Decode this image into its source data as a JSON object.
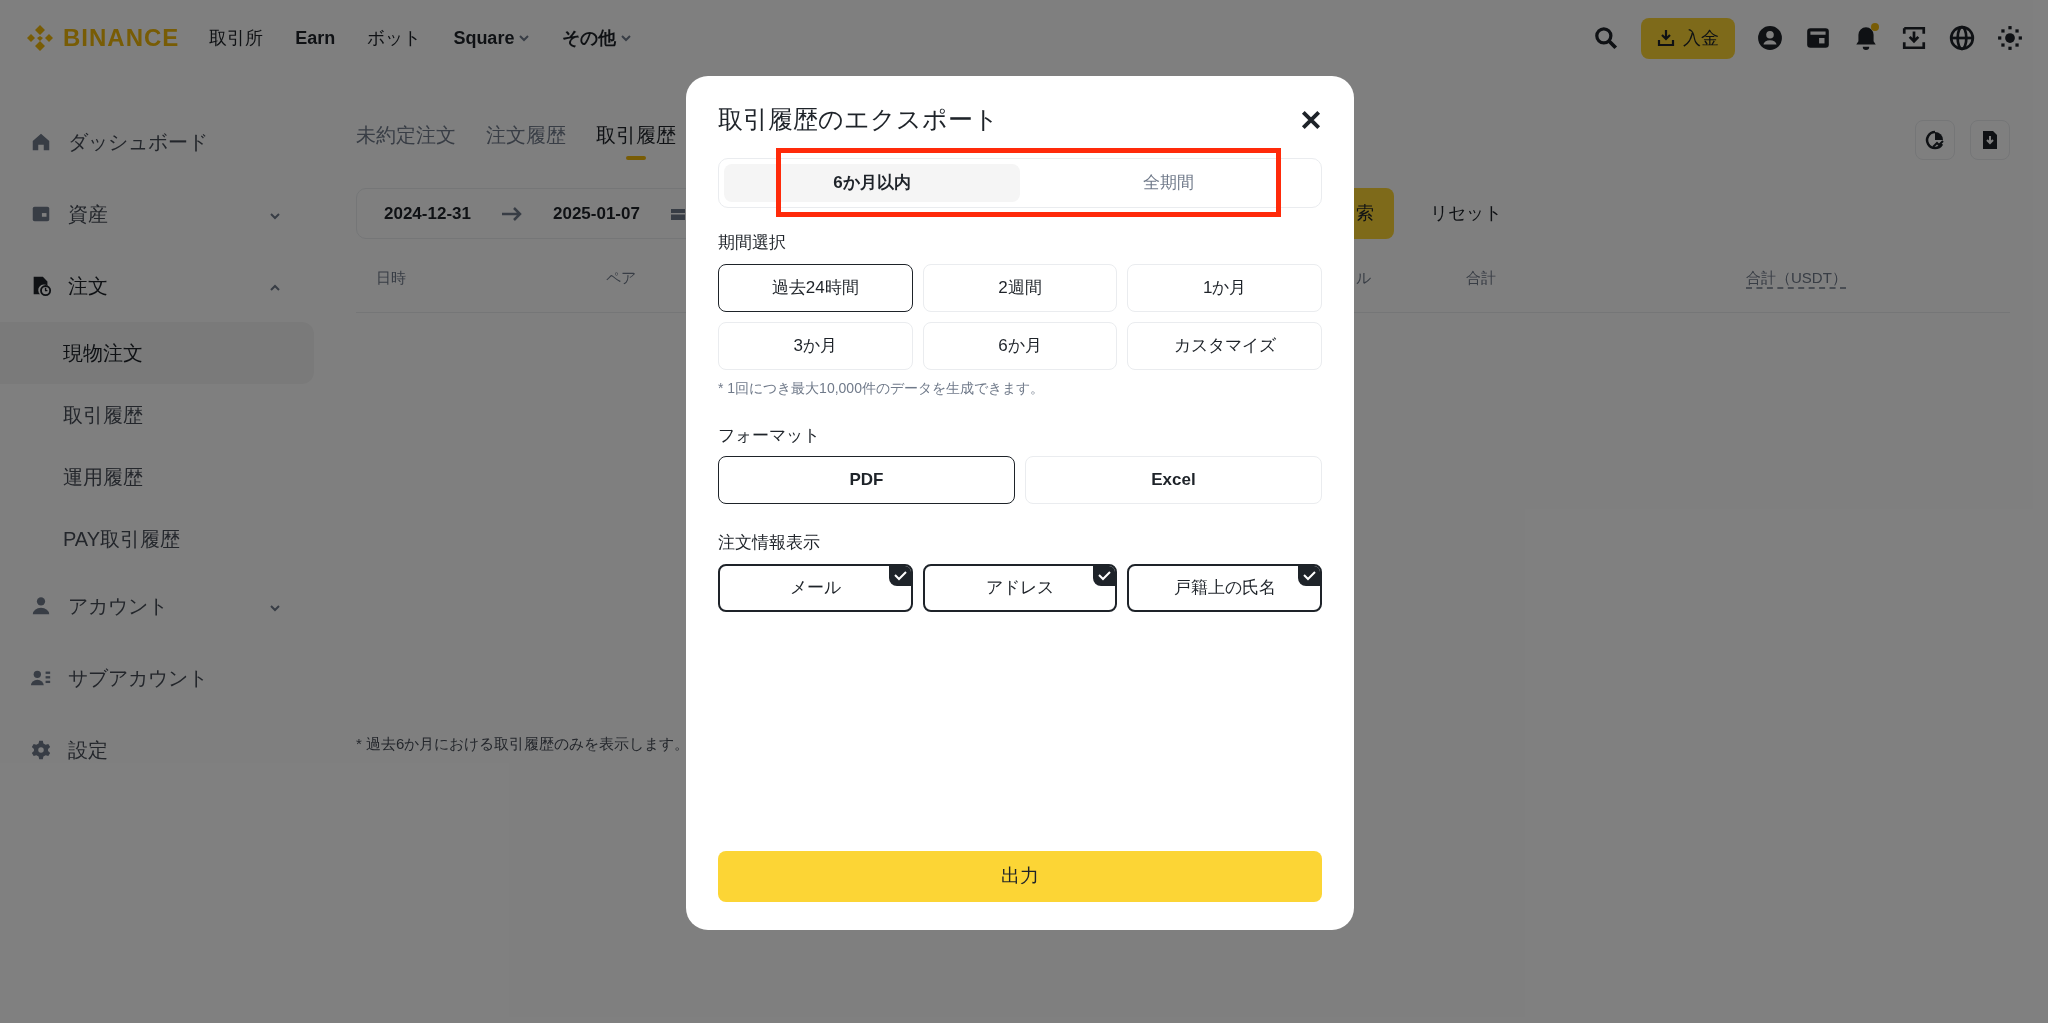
{
  "header": {
    "logo": "BINANCE",
    "nav": [
      {
        "label": "取引所",
        "caret": false
      },
      {
        "label": "Earn",
        "caret": false
      },
      {
        "label": "ボット",
        "caret": false
      },
      {
        "label": "Square",
        "caret": true
      },
      {
        "label": "その他",
        "caret": true
      }
    ],
    "deposit_button": "入金",
    "notification_dot": true
  },
  "sidebar": {
    "items": [
      {
        "label": "ダッシュボード"
      },
      {
        "label": "資産",
        "expanded": false
      },
      {
        "label": "注文",
        "expanded": true,
        "children": [
          {
            "label": "現物注文",
            "selected": true
          },
          {
            "label": "取引履歴",
            "selected": false
          },
          {
            "label": "運用履歴",
            "selected": false
          },
          {
            "label": "PAY取引履歴",
            "selected": false
          }
        ]
      },
      {
        "label": "アカウント",
        "expanded": false
      },
      {
        "label": "サブアカウント"
      },
      {
        "label": "設定"
      }
    ]
  },
  "main": {
    "tabs": [
      {
        "label": "未約定注文",
        "selected": false
      },
      {
        "label": "注文履歴",
        "selected": false
      },
      {
        "label": "取引履歴",
        "selected": true
      }
    ],
    "date_range": {
      "start": "2024-12-31",
      "end": "2025-01-07"
    },
    "search_button": "索",
    "reset_button": "リセット",
    "table": {
      "columns": [
        {
          "label": "日時",
          "underlined": false
        },
        {
          "label": "ペア",
          "underlined": false
        },
        {
          "label": "ル",
          "underlined": false
        },
        {
          "label": "合計",
          "underlined": false
        },
        {
          "label": "合計（USDT）",
          "underlined": true
        }
      ]
    },
    "footnote": "* 過去6か月における取引履歴のみを表示します。"
  },
  "dialog": {
    "title": "取引履歴のエクスポート",
    "highlighted": true,
    "scope_tabs": [
      {
        "label": "6か月以内",
        "selected": true
      },
      {
        "label": "全期間",
        "selected": false
      }
    ],
    "period_label": "期間選択",
    "periods": [
      {
        "label": "過去24時間",
        "selected": true
      },
      {
        "label": "2週間",
        "selected": false
      },
      {
        "label": "1か月",
        "selected": false
      },
      {
        "label": "3か月",
        "selected": false
      },
      {
        "label": "6か月",
        "selected": false
      },
      {
        "label": "カスタマイズ",
        "selected": false
      }
    ],
    "period_note": "* 1回につき最大10,000件のデータを生成できます。",
    "format_label": "フォーマット",
    "formats": [
      {
        "label": "PDF",
        "selected": true
      },
      {
        "label": "Excel",
        "selected": false
      }
    ],
    "info_label": "注文情報表示",
    "info_options": [
      {
        "label": "メール",
        "checked": true
      },
      {
        "label": "アドレス",
        "checked": true
      },
      {
        "label": "戸籍上の氏名",
        "checked": true
      }
    ],
    "submit_button": "出力"
  }
}
